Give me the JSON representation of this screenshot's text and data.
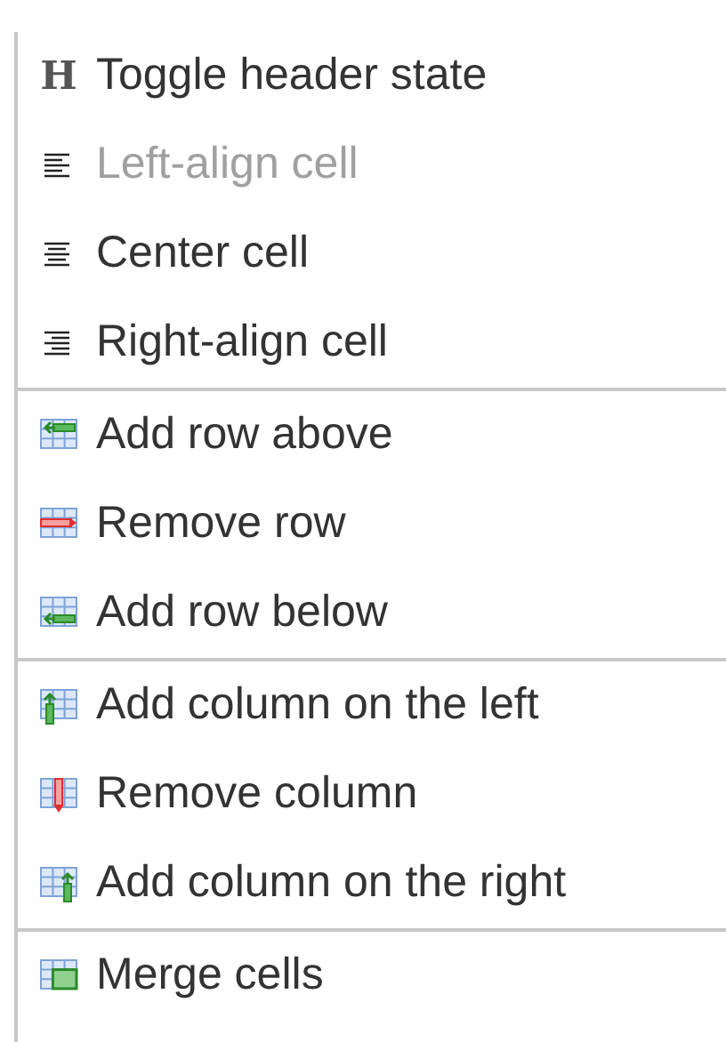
{
  "menu": {
    "groups": [
      {
        "items": [
          {
            "kind": "header",
            "icon_text": "H",
            "label": "Toggle header state",
            "disabled": false
          },
          {
            "kind": "align-left",
            "label": "Left-align cell",
            "disabled": true
          },
          {
            "kind": "align-center",
            "label": "Center cell",
            "disabled": false
          },
          {
            "kind": "align-right",
            "label": "Right-align cell",
            "disabled": false
          }
        ]
      },
      {
        "items": [
          {
            "kind": "row-above",
            "label": "Add row above",
            "disabled": false
          },
          {
            "kind": "row-remove",
            "label": "Remove row",
            "disabled": false
          },
          {
            "kind": "row-below",
            "label": "Add row below",
            "disabled": false
          }
        ]
      },
      {
        "items": [
          {
            "kind": "col-left",
            "label": "Add column on the left",
            "disabled": false
          },
          {
            "kind": "col-remove",
            "label": "Remove column",
            "disabled": false
          },
          {
            "kind": "col-right",
            "label": "Add column on the right",
            "disabled": false
          }
        ]
      },
      {
        "items": [
          {
            "kind": "merge",
            "label": "Merge cells",
            "disabled": false
          }
        ]
      }
    ]
  }
}
